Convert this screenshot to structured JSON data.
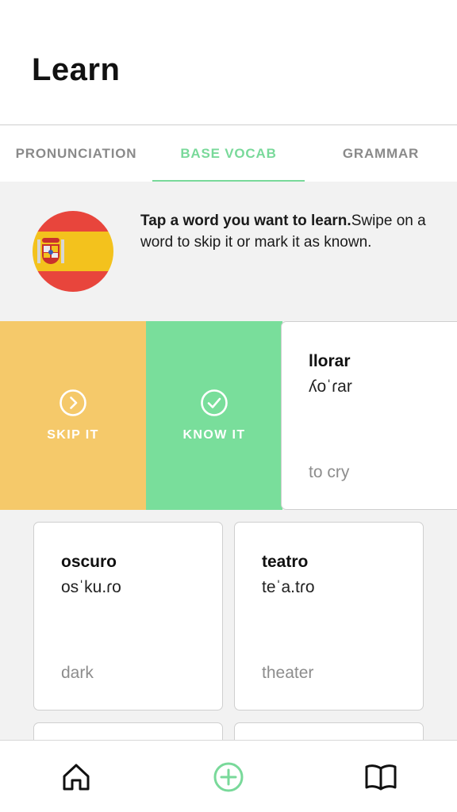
{
  "header": {
    "title": "Learn"
  },
  "tabs": [
    {
      "label": "PRONUNCIATION",
      "active": false
    },
    {
      "label": "BASE VOCAB",
      "active": true
    },
    {
      "label": "GRAMMAR",
      "active": false
    }
  ],
  "intro": {
    "bold": "Tap a word you want to learn.",
    "rest": "Swipe on a word to skip it or mark it as known."
  },
  "swipe_actions": {
    "skip_label": "SKIP IT",
    "know_label": "KNOW IT"
  },
  "swiped_card": {
    "word": "llorar",
    "ipa": "ʎoˈɾar",
    "meaning": "to cry"
  },
  "cards": [
    {
      "word": "oscuro",
      "ipa": "osˈku.ɾo",
      "meaning": "dark"
    },
    {
      "word": "teatro",
      "ipa": "teˈa.tɾo",
      "meaning": "theater"
    }
  ],
  "colors": {
    "accent_green": "#79d99a",
    "skip_yellow": "#f5c96a",
    "know_green": "#79de9b"
  },
  "icons": {
    "tabbar": [
      "home-icon",
      "add-circle-icon",
      "book-icon"
    ]
  }
}
